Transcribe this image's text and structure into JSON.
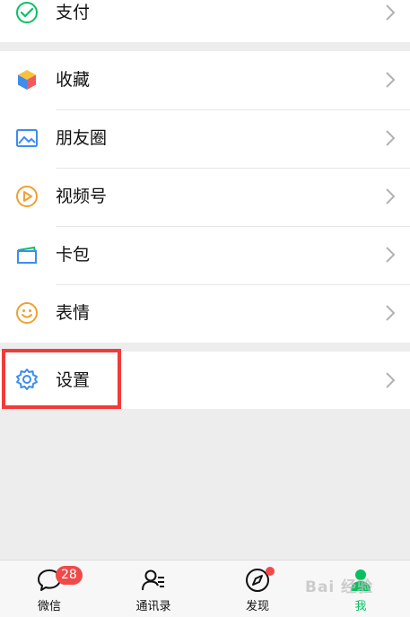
{
  "menu": {
    "pay": {
      "label": "支付",
      "icon": "wechat-pay-icon"
    },
    "items": [
      {
        "label": "收藏",
        "icon": "favorites-cube-icon"
      },
      {
        "label": "朋友圈",
        "icon": "moments-photo-icon"
      },
      {
        "label": "视频号",
        "icon": "channels-play-icon"
      },
      {
        "label": "卡包",
        "icon": "card-wallet-icon"
      },
      {
        "label": "表情",
        "icon": "sticker-smile-icon"
      }
    ],
    "settings": {
      "label": "设置",
      "icon": "gear-icon",
      "highlight_color": "#f43a3a"
    }
  },
  "tabbar": {
    "tabs": [
      {
        "label": "微信",
        "icon": "chat-bubble-icon",
        "badge": "28"
      },
      {
        "label": "通讯录",
        "icon": "contacts-icon"
      },
      {
        "label": "发现",
        "icon": "discover-compass-icon",
        "dot": true
      },
      {
        "label": "我",
        "icon": "me-person-icon",
        "active": true
      }
    ]
  },
  "watermark": "Bai 经验",
  "colors": {
    "accent": "#07c160",
    "badge": "#f0494a",
    "background": "#ededed"
  }
}
